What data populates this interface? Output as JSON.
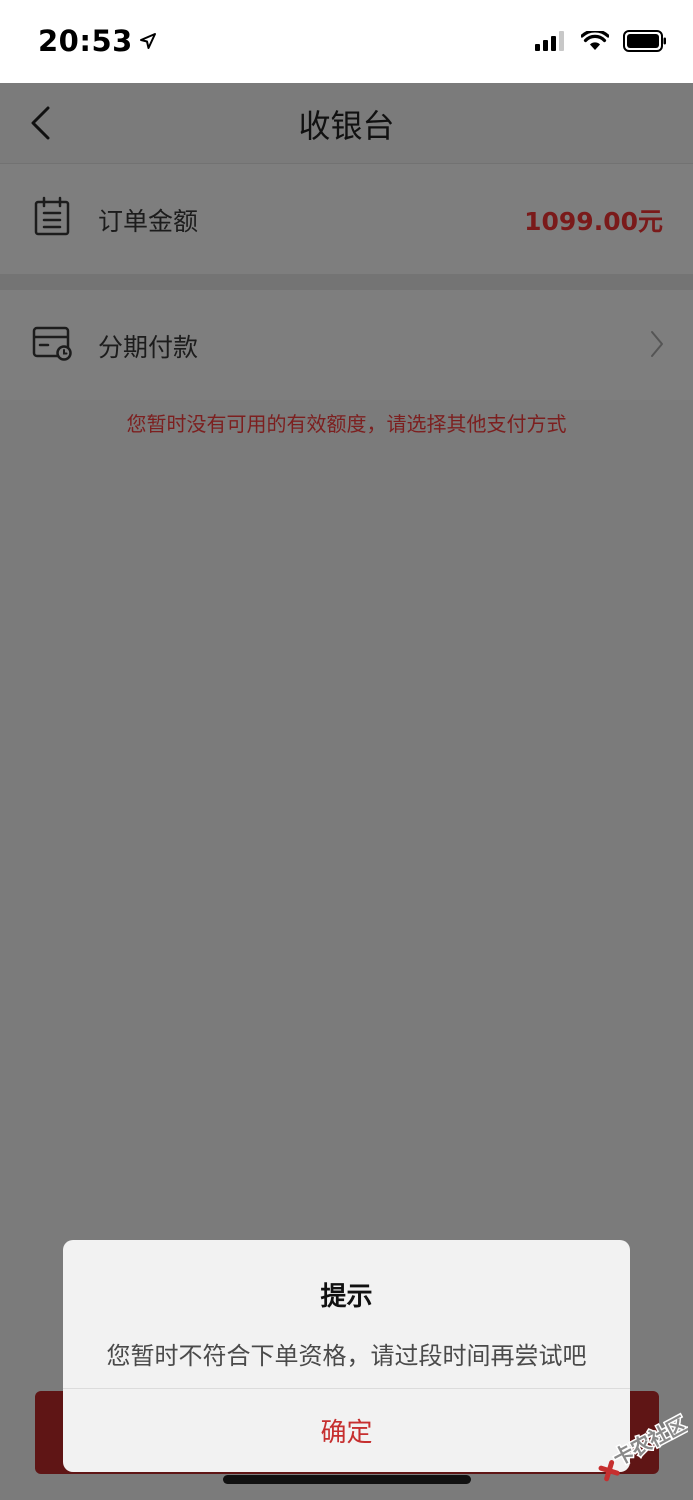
{
  "status_bar": {
    "time": "20:53"
  },
  "nav": {
    "title": "收银台"
  },
  "order": {
    "label": "订单金额",
    "amount": "1099.00元"
  },
  "installment": {
    "label": "分期付款"
  },
  "notice": "您暂时没有可用的有效额度，请选择其他支付方式",
  "modal": {
    "title": "提示",
    "message": "您暂时不符合下单资格，请过段时间再尝试吧",
    "confirm": "确定"
  },
  "watermark": {
    "text": "卡农社区"
  },
  "colors": {
    "overlay_bg": "#7b7b7b",
    "accent_red": "#c62f2f",
    "amount_red": "#7a1a1a",
    "button_red_dim": "#5f1515"
  },
  "icons": {
    "location": "location-arrow-icon",
    "signal": "cellular-signal-icon",
    "wifi": "wifi-icon",
    "battery": "battery-icon",
    "back": "chevron-left-icon",
    "order": "clipboard-icon",
    "installment": "card-clock-icon",
    "chevron": "chevron-right-icon"
  }
}
